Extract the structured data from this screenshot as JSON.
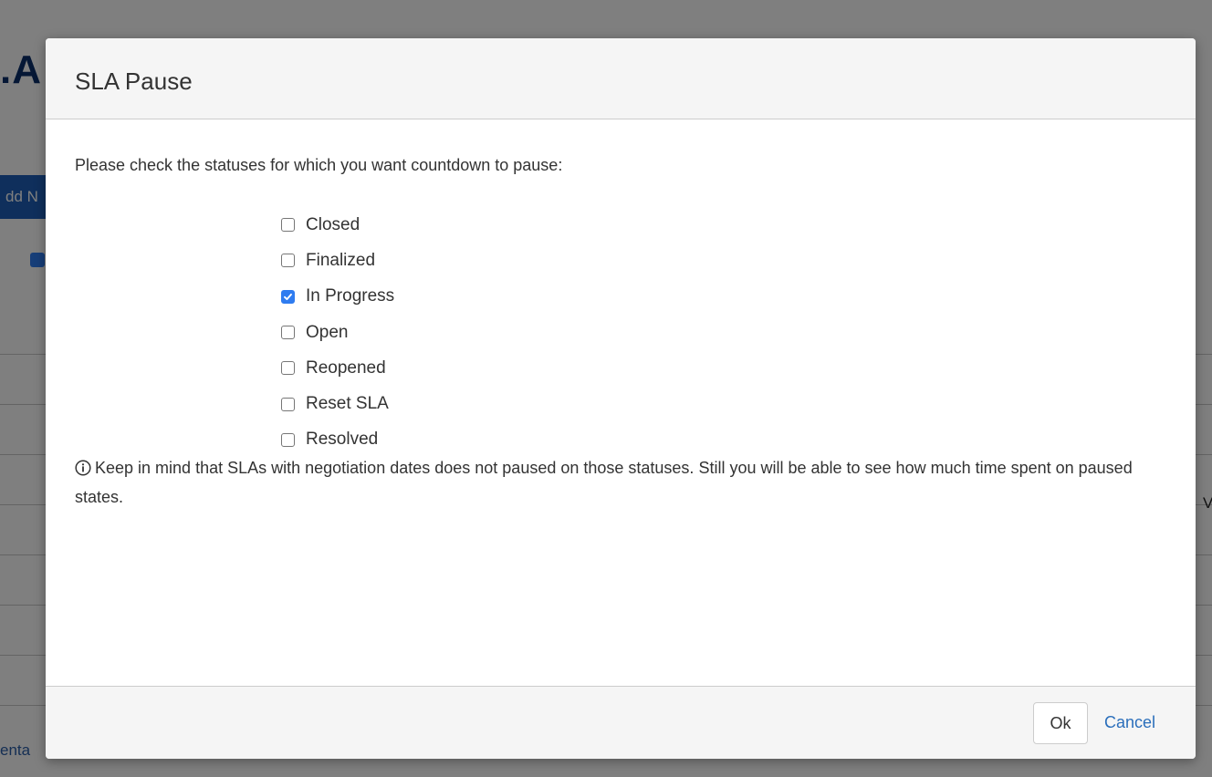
{
  "background": {
    "page_title_fragment": ".A",
    "add_button_fragment": "dd N",
    "bottom_link_fragment": "enta",
    "right_edge_fragment": "V"
  },
  "dialog": {
    "title": "SLA Pause",
    "instruction": "Please check the statuses for which you want countdown to pause:",
    "statuses": [
      {
        "label": "Closed",
        "checked": false
      },
      {
        "label": "Finalized",
        "checked": false
      },
      {
        "label": "In Progress",
        "checked": true
      },
      {
        "label": "Open",
        "checked": false
      },
      {
        "label": "Reopened",
        "checked": false
      },
      {
        "label": "Reset SLA",
        "checked": false
      },
      {
        "label": "Resolved",
        "checked": false
      }
    ],
    "note": "Keep in mind that SLAs with negotiation dates does not paused on those statuses. Still you will be able to see how much time spent on paused states.",
    "note_icon": "info-circle-icon",
    "ok_label": "Ok",
    "cancel_label": "Cancel"
  },
  "colors": {
    "accent": "#2f7cf0",
    "link": "#2a6ebb",
    "overlay": "rgba(0,0,0,0.5)"
  }
}
